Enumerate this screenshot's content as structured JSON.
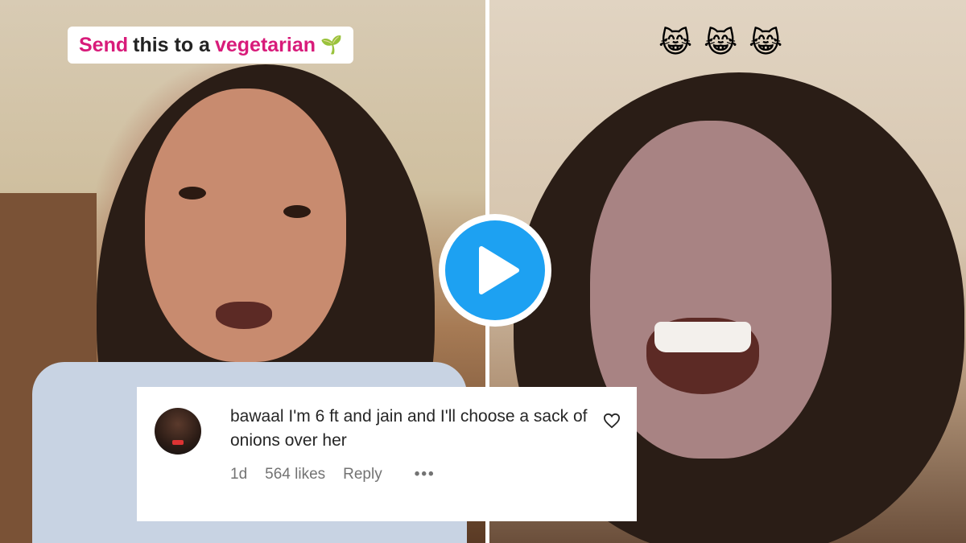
{
  "caption": {
    "word1": "Send",
    "word2": "this to a",
    "word3": "vegetarian",
    "sprout": "🌱"
  },
  "reaction_emojis": [
    "😹",
    "😹",
    "😹"
  ],
  "comment": {
    "username": "bawaal",
    "text": "I'm 6 ft and jain and I'll choose a sack of onions over her",
    "time": "1d",
    "likes": "564 likes",
    "reply_label": "Reply",
    "more_label": "•••"
  },
  "colors": {
    "accent_pink": "#d81b7a",
    "play_blue": "#1da1f2"
  },
  "icons": {
    "play": "play-icon",
    "like": "heart-outline-icon",
    "more": "more-options-icon"
  }
}
